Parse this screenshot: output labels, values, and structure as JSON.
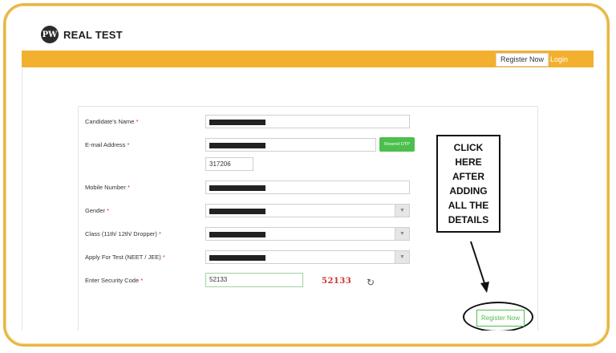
{
  "brand": {
    "logo_mark": "PW",
    "name": "REAL TEST"
  },
  "nav": {
    "register_label": "Register Now",
    "login_label": "Login"
  },
  "form": {
    "fields": [
      {
        "label": "Candidate's Name",
        "required": "*"
      },
      {
        "label": "E-mail Address",
        "required": "*"
      },
      {
        "label": "Mobile Number",
        "required": "*"
      },
      {
        "label": "Gender",
        "required": "*"
      },
      {
        "label": "Class (11th/ 12th/ Dropper)",
        "required": "*"
      },
      {
        "label": "Apply For Test (NEET / JEE)",
        "required": "*"
      },
      {
        "label": "Enter Security Code",
        "required": "*"
      }
    ],
    "otp_value": "317206",
    "resend_otp_label": "Resend OTP",
    "security_code_value": "52133",
    "captcha_text": "52133",
    "register_button_label": "Register Now"
  },
  "annotation": {
    "callout_text": "CLICK\nHERE\nAFTER\nADDING\nALL THE\nDETAILS"
  },
  "colors": {
    "navbar": "#f2b02e",
    "accent_green": "#4cbf4c",
    "captcha_red": "#d0312d",
    "frame_gold": "#e8b640"
  }
}
